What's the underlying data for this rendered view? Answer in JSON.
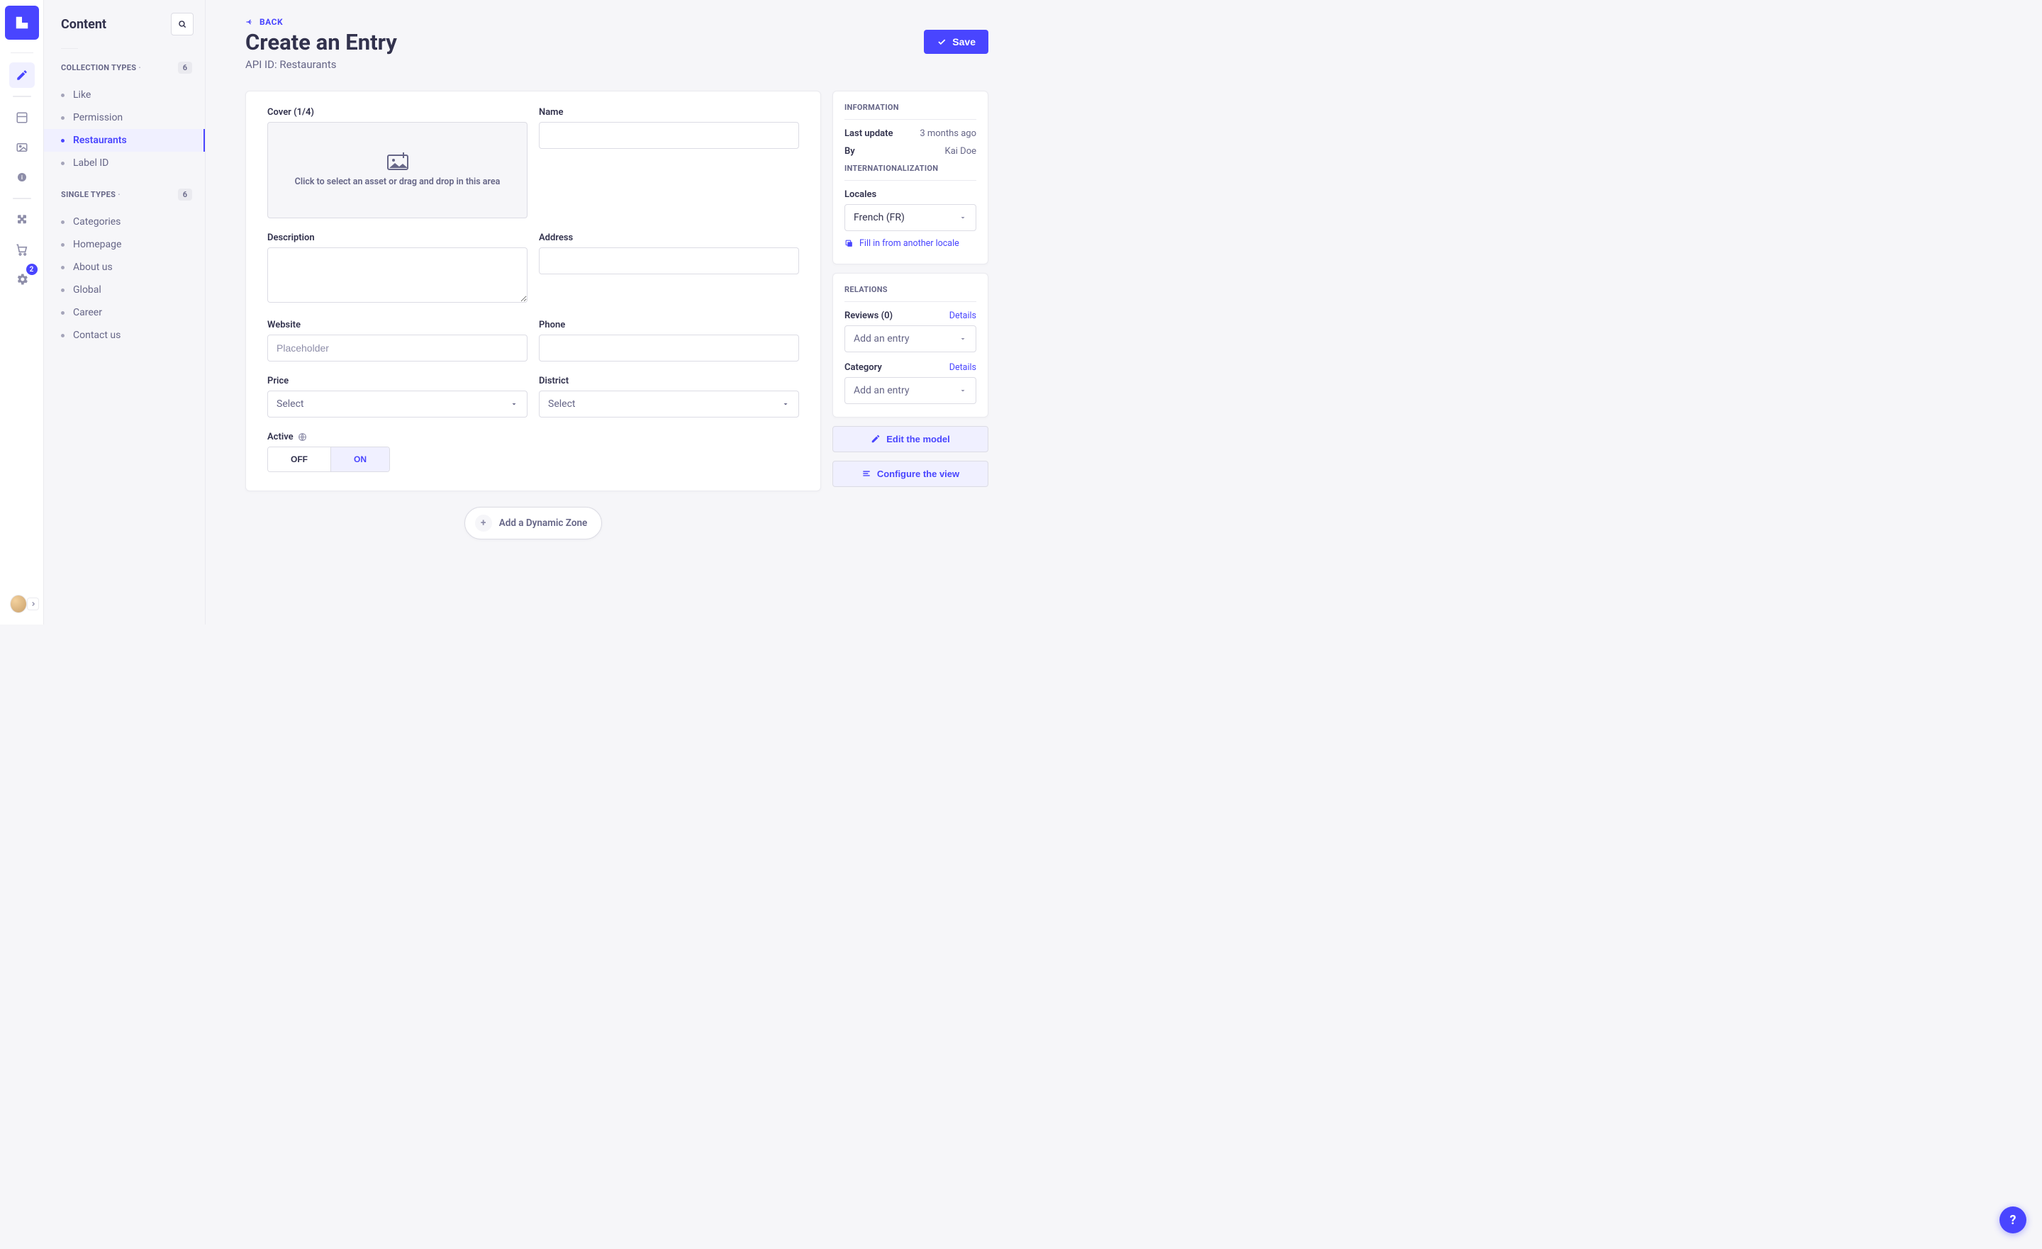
{
  "sidebar": {
    "title": "Content",
    "collection_label": "Collection Types",
    "collection_count": "6",
    "collection_items": [
      "Like",
      "Permission",
      "Restaurants",
      "Label ID"
    ],
    "collection_active_index": 2,
    "single_label": "Single Types",
    "single_count": "6",
    "single_items": [
      "Categories",
      "Homepage",
      "About us",
      "Global",
      "Career",
      "Contact us"
    ]
  },
  "settings_badge": "2",
  "header": {
    "back": "BACK",
    "title": "Create an Entry",
    "subtitle": "API ID: Restaurants",
    "save": "Save"
  },
  "form": {
    "cover_label": "Cover (1/4)",
    "cover_drop": "Click to select an asset or drag and drop in this area",
    "name_label": "Name",
    "description_label": "Description",
    "address_label": "Address",
    "website_label": "Website",
    "website_placeholder": "Placeholder",
    "phone_label": "Phone",
    "price_label": "Price",
    "price_value": "Select",
    "district_label": "District",
    "district_value": "Select",
    "active_label": "Active",
    "off_label": "OFF",
    "on_label": "ON"
  },
  "info_panel": {
    "title": "Information",
    "last_update_label": "Last update",
    "last_update_value": "3 months ago",
    "by_label": "By",
    "by_value": "Kai Doe",
    "i18n_title": "Internationalization",
    "locales_label": "Locales",
    "locale_value": "French (FR)",
    "fill_link": "Fill in from another locale"
  },
  "relations": {
    "title": "Relations",
    "reviews_label": "Reviews (0)",
    "details_label": "Details",
    "add_entry": "Add an entry",
    "category_label": "Category"
  },
  "actions": {
    "edit_model": "Edit the model",
    "configure_view": "Configure the view",
    "add_dynamic_zone": "Add a Dynamic Zone"
  }
}
